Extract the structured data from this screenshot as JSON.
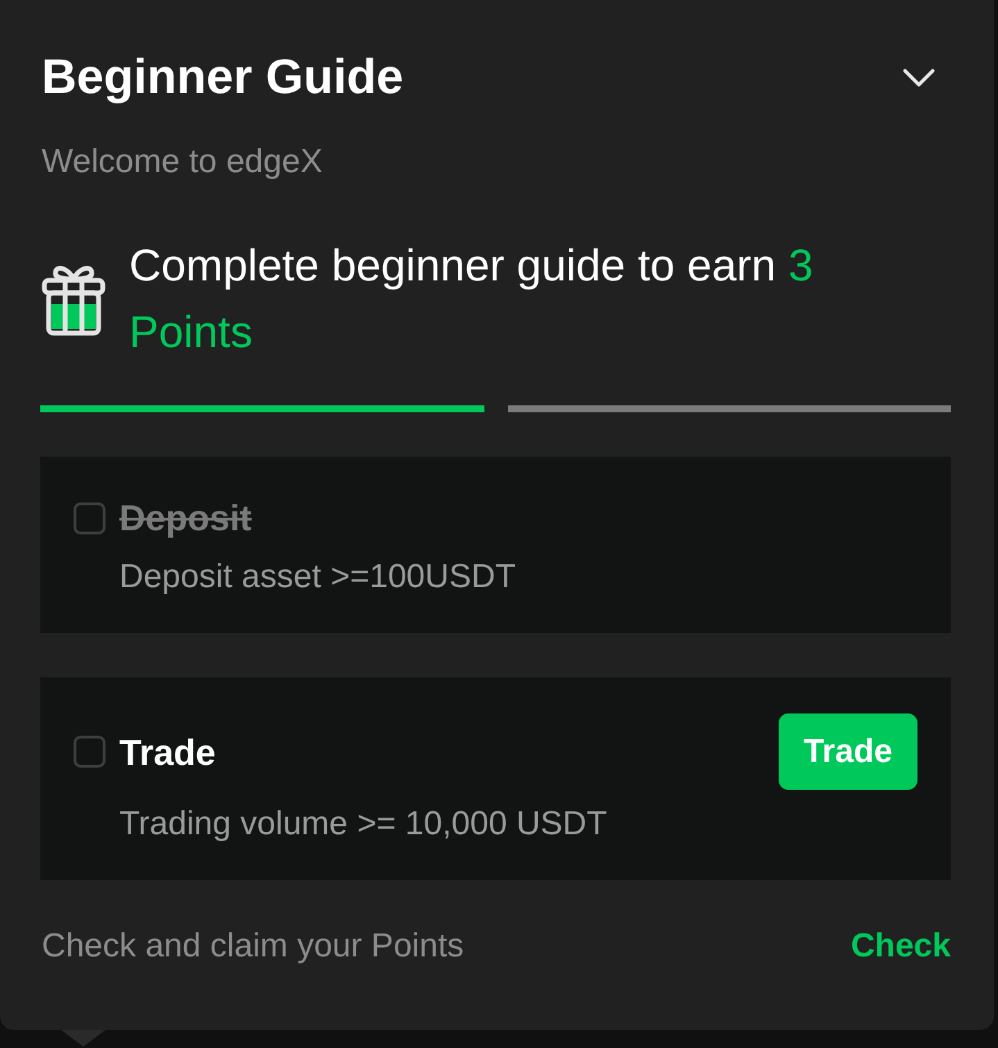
{
  "panel": {
    "title": "Beginner Guide",
    "subtitle": "Welcome to edgeX"
  },
  "reward": {
    "text": "Complete beginner guide to earn",
    "highlight": "3 Points"
  },
  "tasks": [
    {
      "title": "Deposit",
      "description": "Deposit asset >=100USDT",
      "checked": false,
      "completed": true
    },
    {
      "title": "Trade",
      "description": "Trading volume >= 10,000 USDT",
      "checked": false,
      "completed": false,
      "button": "Trade"
    }
  ],
  "footer": {
    "text": "Check and claim your Points",
    "link": "Check"
  }
}
